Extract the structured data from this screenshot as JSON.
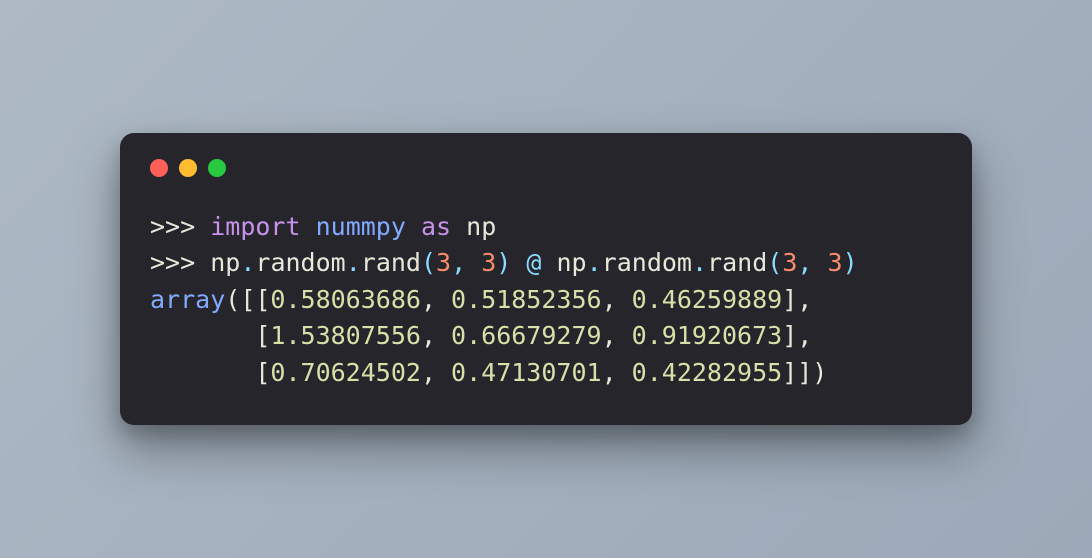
{
  "colors": {
    "window_red": "#ff5f57",
    "window_yellow": "#febc2e",
    "window_green": "#28c840",
    "terminal_bg": "#26252b"
  },
  "code": {
    "prompt": ">>> ",
    "line1": {
      "import": "import",
      "module": "nummpy",
      "as": "as",
      "alias": "np"
    },
    "line2": {
      "np1": "np",
      "dot1": ".",
      "random1": "random",
      "dot2": ".",
      "rand1": "rand",
      "lp1": "(",
      "n1": "3",
      "c1": ", ",
      "n2": "3",
      "rp1": ")",
      "at": " @ ",
      "np2": "np",
      "dot3": ".",
      "random2": "random",
      "dot4": ".",
      "rand2": "rand",
      "lp2": "(",
      "n3": "3",
      "c2": ", ",
      "n4": "3",
      "rp2": ")"
    },
    "output": {
      "array_kw": "array",
      "open": "([[",
      "r0c0": "0.58063686",
      "r0c1": "0.51852356",
      "r0c2": "0.46259889",
      "row_end": "],",
      "indent": "       [",
      "r1c0": "1.53807556",
      "r1c1": "0.66679279",
      "r1c2": "0.91920673",
      "r2c0": "0.70624502",
      "r2c1": "0.47130701",
      "r2c2": "0.42282955",
      "close": "]])",
      "sep": ", "
    }
  }
}
